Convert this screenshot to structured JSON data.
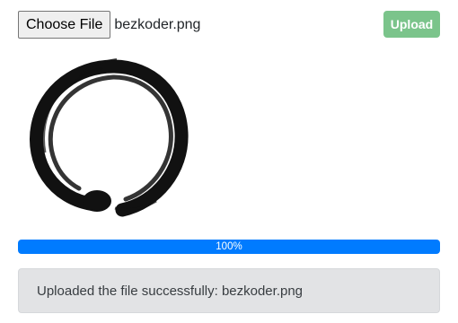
{
  "file_input": {
    "button_label": "Choose File",
    "selected_file": "bezkoder.png"
  },
  "upload_button": {
    "label": "Upload",
    "color": "#7bc48b"
  },
  "preview": {
    "icon": "enso-circle-image",
    "color": "#111111"
  },
  "progress": {
    "value": 100,
    "label": "100%",
    "color": "#007bff"
  },
  "message": {
    "text": "Uploaded the file successfully: bezkoder.png"
  }
}
